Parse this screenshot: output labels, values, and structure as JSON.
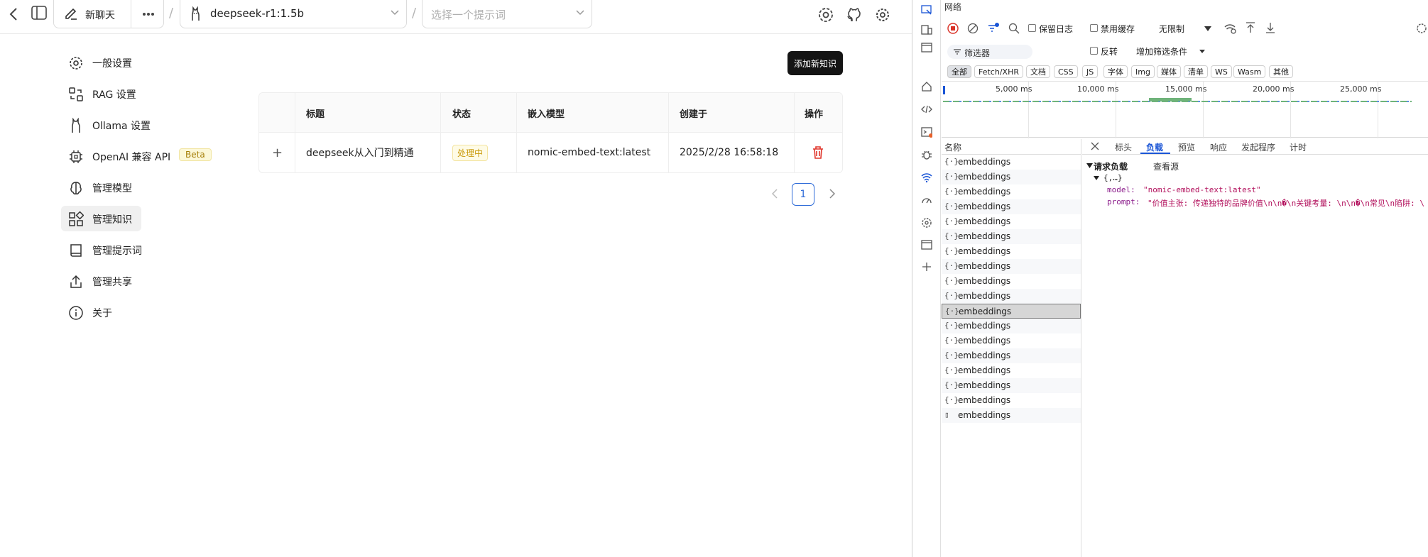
{
  "topbar": {
    "new_chat_label": "新聊天",
    "separator": "/",
    "model_label": "deepseek-r1:1.5b",
    "prompt_placeholder": "选择一个提示词"
  },
  "sidebar": {
    "items": [
      {
        "label": "一般设置",
        "icon": "gear-icon"
      },
      {
        "label": "RAG 设置",
        "icon": "rag-icon"
      },
      {
        "label": "Ollama 设置",
        "icon": "llama-icon"
      },
      {
        "label": "OpenAI 兼容 API",
        "icon": "chip-icon",
        "badge": "Beta"
      },
      {
        "label": "管理模型",
        "icon": "brain-icon"
      },
      {
        "label": "管理知识",
        "icon": "grid-icon",
        "active": true
      },
      {
        "label": "管理提示词",
        "icon": "book-icon"
      },
      {
        "label": "管理共享",
        "icon": "share-icon"
      },
      {
        "label": "关于",
        "icon": "info-icon"
      }
    ]
  },
  "knowledge": {
    "add_button": "添加新知识",
    "columns": [
      "标题",
      "状态",
      "嵌入模型",
      "创建于",
      "操作"
    ],
    "rows": [
      {
        "expand": "+",
        "title": "deepseek从入门到精通",
        "status": "处理中",
        "model": "nomic-embed-text:latest",
        "created": "2025/2/28 16:58:18"
      }
    ],
    "page": "1"
  },
  "devtools": {
    "title": "网络",
    "toolbar": {
      "preserve_log": "保留日志",
      "disable_cache": "禁用缓存",
      "throttle": "无限制"
    },
    "filter": {
      "placeholder": "筛选器",
      "invert": "反转",
      "more_filters": "增加筛选条件"
    },
    "types": [
      "全部",
      "Fetch/XHR",
      "文档",
      "CSS",
      "JS",
      "字体",
      "Img",
      "媒体",
      "清单",
      "WS",
      "Wasm",
      "其他"
    ],
    "timeline_ticks": [
      "5,000 ms",
      "10,000 ms",
      "15,000 ms",
      "20,000 ms",
      "25,000 ms"
    ],
    "names_header": "名称",
    "requests": [
      "embeddings",
      "embeddings",
      "embeddings",
      "embeddings",
      "embeddings",
      "embeddings",
      "embeddings",
      "embeddings",
      "embeddings",
      "embeddings",
      "embeddings",
      "embeddings",
      "embeddings",
      "embeddings",
      "embeddings",
      "embeddings",
      "embeddings",
      "embeddings"
    ],
    "selected_index": 10,
    "detail_tabs": [
      "标头",
      "负载",
      "预览",
      "响应",
      "发起程序",
      "计时"
    ],
    "active_tab": "负载",
    "payload": {
      "section": "请求负载",
      "view_source": "查看源",
      "root": "{,…}",
      "model_key": "model:",
      "model_value": "\"nomic-embed-text:latest\"",
      "prompt_key": "prompt:",
      "prompt_value": "\"价值主张: 传递独特的品牌价值\\n\\n�\\n关键考量: \\n\\n�\\n常见\\n陷阱: \\n\\n"
    }
  }
}
